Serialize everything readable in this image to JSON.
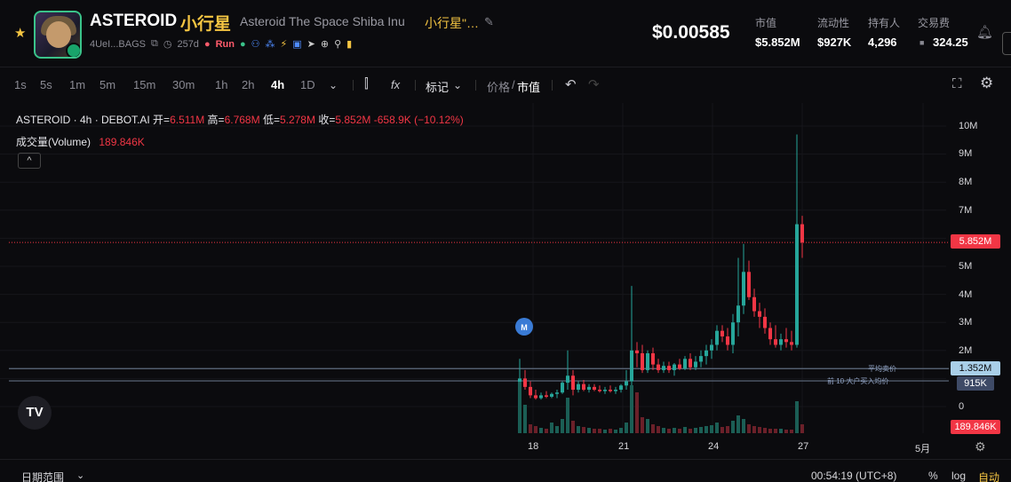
{
  "header": {
    "token_symbol": "ASTEROID",
    "token_cn": "小行星",
    "token_name": "Asteroid The Space Shiba Inu",
    "token_name_cn": "小行星\"…",
    "address": "4UeI...BAGS",
    "age": "257d",
    "run_label": "Run",
    "price": "$0.00585",
    "stats": [
      {
        "label": "市值",
        "value": "$5.852M"
      },
      {
        "label": "流动性",
        "value": "$927K"
      },
      {
        "label": "持有人",
        "value": "4,296"
      },
      {
        "label": "交易费",
        "value": "324.25"
      }
    ]
  },
  "toolbar": {
    "timeframes": [
      "1s",
      "5s",
      "1m",
      "5m",
      "15m",
      "30m",
      "1h",
      "2h",
      "4h",
      "1D"
    ],
    "active_timeframe": "4h",
    "marks_label": "标记",
    "price_label": "价格",
    "mcap_label": "市值"
  },
  "chart": {
    "legend": {
      "pair": "ASTEROID · 4h · DEBOT.AI",
      "open_label": "开=",
      "open": "6.511M",
      "high_label": "高=",
      "high": "6.768M",
      "low_label": "低=",
      "low": "5.278M",
      "close_label": "收=",
      "close": "5.852M",
      "change": "-658.9K (−10.12%)"
    },
    "volume_label": "成交量(Volume)",
    "volume_value": "189.846K",
    "collapse_glyph": "^",
    "marker_label": "M",
    "current_tag": "5.852M",
    "avg_price_label": "平均卖价",
    "avg_price_tag": "1.352M",
    "top10_label": "前 10 大户买入均价",
    "top10_tag": "915K",
    "volume_tag": "189.846K",
    "y_labels": [
      "10M",
      "9M",
      "8M",
      "7M",
      "6M",
      "5M",
      "4M",
      "3M",
      "2M",
      "1M",
      "0"
    ],
    "x_labels": [
      "18",
      "21",
      "24",
      "27",
      "5月"
    ]
  },
  "chart_data": {
    "type": "candlestick",
    "ylim": [
      0,
      10000000
    ],
    "current": 5852000,
    "avg_sell": 1352000,
    "top10_avg_buy": 915000,
    "x_ticks": [
      "18",
      "21",
      "24",
      "27",
      "5月"
    ],
    "colors": {
      "up": "#26a69a",
      "down": "#f23645"
    }
  },
  "footer": {
    "date_range_label": "日期范围",
    "time": "00:54:19 (UTC+8)",
    "pct_label": "%",
    "log_label": "log",
    "auto_label": "自动"
  }
}
